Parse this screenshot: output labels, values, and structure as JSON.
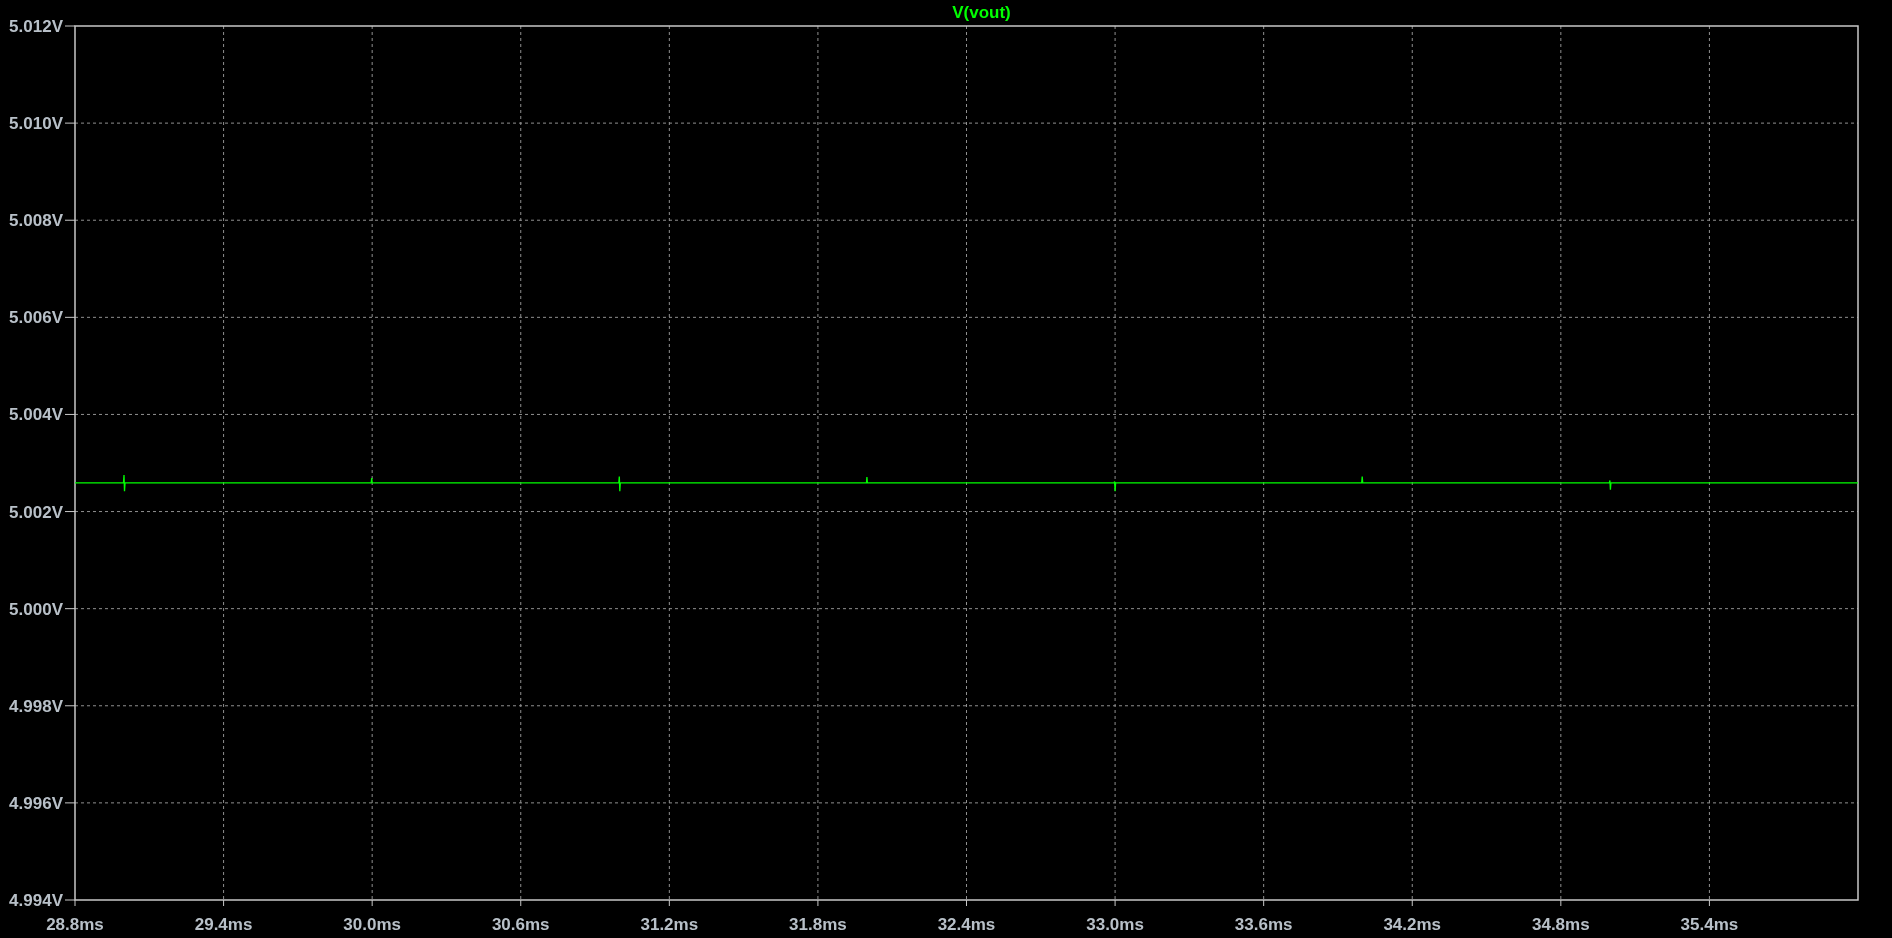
{
  "plot": {
    "chart_data": {
      "type": "line",
      "grid": true,
      "x": [
        28.8,
        28.996,
        28.998,
        29.0,
        29.002,
        29.004,
        29.996,
        29.998,
        30.0,
        30.002,
        30.996,
        30.998,
        31.0,
        31.002,
        31.004,
        31.996,
        31.998,
        32.0,
        32.002,
        32.996,
        32.998,
        33.0,
        33.002,
        33.996,
        33.998,
        34.0,
        34.002,
        34.996,
        34.998,
        35.0,
        35.002,
        36.0
      ],
      "series": [
        {
          "name": "V(vout)",
          "color": "#00ff00",
          "values": [
            5.00259,
            5.00259,
            5.00275,
            5.00242,
            5.00259,
            5.00259,
            5.00259,
            5.00269,
            5.00259,
            5.00259,
            5.00259,
            5.00272,
            5.00242,
            5.00259,
            5.00259,
            5.00259,
            5.00271,
            5.00259,
            5.00259,
            5.00259,
            5.00262,
            5.00242,
            5.00259,
            5.00259,
            5.00272,
            5.00259,
            5.00259,
            5.00259,
            5.00264,
            5.00245,
            5.00259,
            5.00259
          ]
        }
      ],
      "xlim": [
        28.8,
        36.0
      ],
      "ylim": [
        4.994,
        5.012
      ],
      "xticks": [
        {
          "value": 28.8,
          "label": "28.8ms"
        },
        {
          "value": 29.4,
          "label": "29.4ms"
        },
        {
          "value": 30.0,
          "label": "30.0ms"
        },
        {
          "value": 30.6,
          "label": "30.6ms"
        },
        {
          "value": 31.2,
          "label": "31.2ms"
        },
        {
          "value": 31.8,
          "label": "31.8ms"
        },
        {
          "value": 32.4,
          "label": "32.4ms"
        },
        {
          "value": 33.0,
          "label": "33.0ms"
        },
        {
          "value": 33.6,
          "label": "33.6ms"
        },
        {
          "value": 34.2,
          "label": "34.2ms"
        },
        {
          "value": 34.8,
          "label": "34.8ms"
        },
        {
          "value": 35.4,
          "label": "35.4ms"
        }
      ],
      "yticks": [
        {
          "value": 5.012,
          "label": "5.012V"
        },
        {
          "value": 5.01,
          "label": "5.010V"
        },
        {
          "value": 5.008,
          "label": "5.008V"
        },
        {
          "value": 5.006,
          "label": "5.006V"
        },
        {
          "value": 5.004,
          "label": "5.004V"
        },
        {
          "value": 5.002,
          "label": "5.002V"
        },
        {
          "value": 5.0,
          "label": "5.000V"
        },
        {
          "value": 4.998,
          "label": "4.998V"
        },
        {
          "value": 4.996,
          "label": "4.996V"
        },
        {
          "value": 4.994,
          "label": "4.994V"
        }
      ]
    }
  }
}
